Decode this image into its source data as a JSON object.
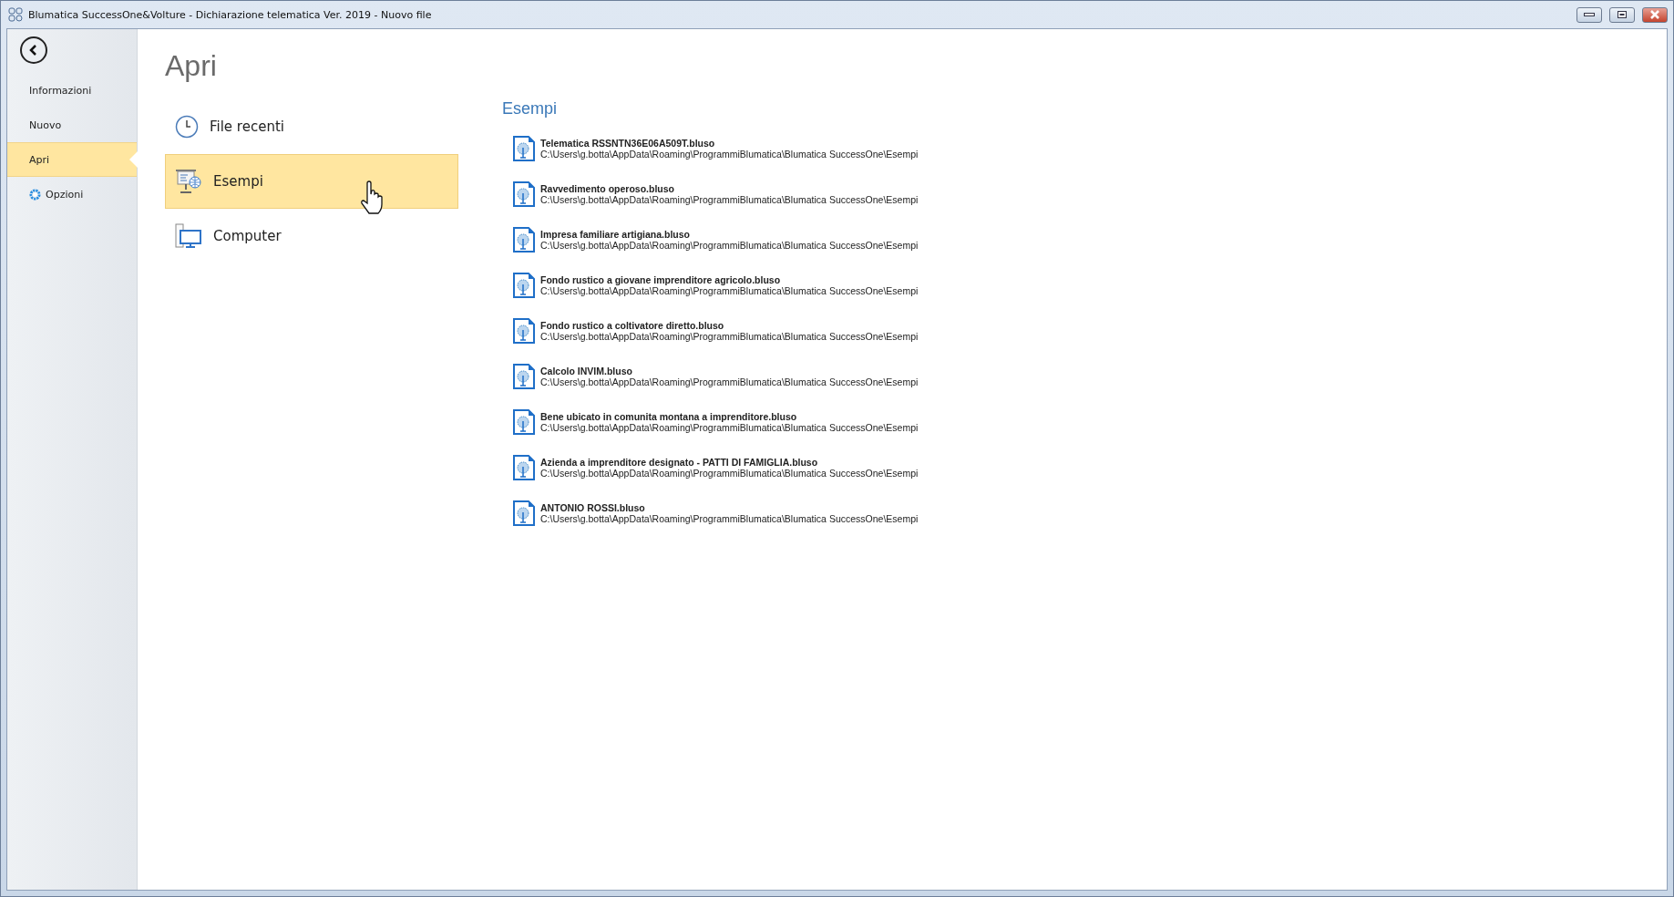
{
  "window": {
    "title": "Blumatica SuccessOne&Volture - Dichiarazione telematica Ver. 2019 - Nuovo file"
  },
  "sidebar": {
    "items": [
      {
        "label": "Informazioni",
        "kind": "text",
        "selected": false
      },
      {
        "label": "Nuovo",
        "kind": "text",
        "selected": false
      },
      {
        "label": "Apri",
        "kind": "text",
        "selected": true
      },
      {
        "label": "Opzioni",
        "kind": "option",
        "selected": false
      }
    ]
  },
  "page_title": "Apri",
  "places": [
    {
      "label": "File recenti",
      "kind": "recent",
      "selected": false
    },
    {
      "label": "Esempi",
      "kind": "examples",
      "selected": true
    },
    {
      "label": "Computer",
      "kind": "computer",
      "selected": false
    }
  ],
  "files_panel": {
    "title": "Esempi",
    "files": [
      {
        "name": "Telematica RSSNTN36E06A509T.bluso",
        "path": "C:\\Users\\g.botta\\AppData\\Roaming\\ProgrammiBlumatica\\Blumatica SuccessOne\\Esempi"
      },
      {
        "name": "Ravvedimento operoso.bluso",
        "path": "C:\\Users\\g.botta\\AppData\\Roaming\\ProgrammiBlumatica\\Blumatica SuccessOne\\Esempi"
      },
      {
        "name": "Impresa familiare artigiana.bluso",
        "path": "C:\\Users\\g.botta\\AppData\\Roaming\\ProgrammiBlumatica\\Blumatica SuccessOne\\Esempi"
      },
      {
        "name": "Fondo rustico a giovane imprenditore agricolo.bluso",
        "path": "C:\\Users\\g.botta\\AppData\\Roaming\\ProgrammiBlumatica\\Blumatica SuccessOne\\Esempi"
      },
      {
        "name": "Fondo rustico a coltivatore diretto.bluso",
        "path": "C:\\Users\\g.botta\\AppData\\Roaming\\ProgrammiBlumatica\\Blumatica SuccessOne\\Esempi"
      },
      {
        "name": "Calcolo INVIM.bluso",
        "path": "C:\\Users\\g.botta\\AppData\\Roaming\\ProgrammiBlumatica\\Blumatica SuccessOne\\Esempi"
      },
      {
        "name": "Bene ubicato in comunita montana a imprenditore.bluso",
        "path": "C:\\Users\\g.botta\\AppData\\Roaming\\ProgrammiBlumatica\\Blumatica SuccessOne\\Esempi"
      },
      {
        "name": "Azienda a imprenditore designato - PATTI DI FAMIGLIA.bluso",
        "path": "C:\\Users\\g.botta\\AppData\\Roaming\\ProgrammiBlumatica\\Blumatica SuccessOne\\Esempi"
      },
      {
        "name": "ANTONIO ROSSI.bluso",
        "path": "C:\\Users\\g.botta\\AppData\\Roaming\\ProgrammiBlumatica\\Blumatica SuccessOne\\Esempi"
      }
    ]
  }
}
